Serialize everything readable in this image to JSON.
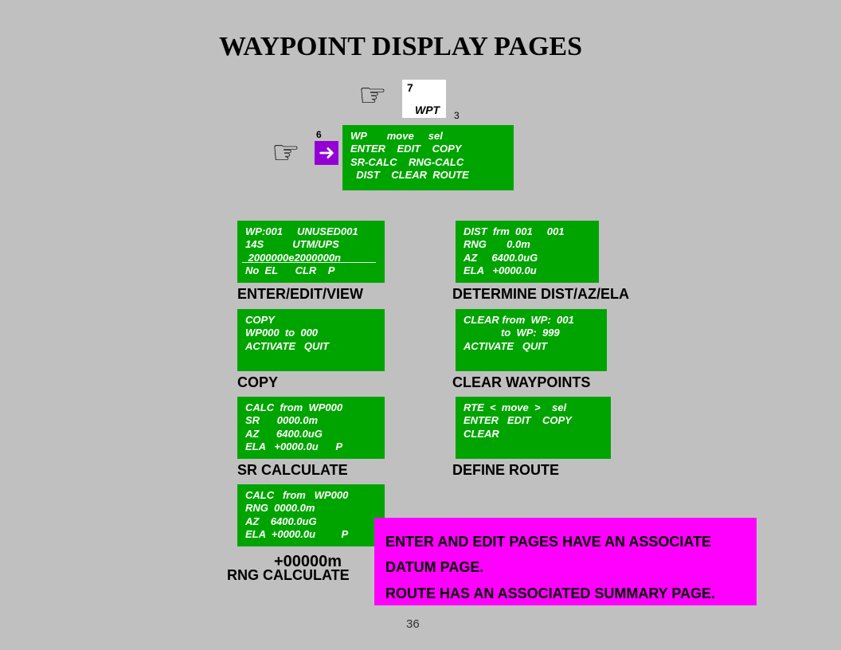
{
  "title": "WAYPOINT DISPLAY PAGES",
  "page_number": "36",
  "wpt_box": {
    "digit": "7",
    "label": "WPT",
    "side_digit": "3"
  },
  "menu_panel": {
    "line1": "WP       move     sel",
    "line2": "ENTER    EDIT    COPY",
    "line3": "SR-CALC    RNG-CALC",
    "line4": "  DIST    CLEAR  ROUTE"
  },
  "enter_key_digit": "6",
  "panels": {
    "enter_edit": {
      "l1": "WP:001     UNUSED001",
      "l2": "14S          UTM/UPS",
      "l3": " 2000000e2000000n",
      "l4": "No  EL      CLR    P",
      "caption": "ENTER/EDIT/VIEW"
    },
    "dist": {
      "l1": "DIST  frm  001     001",
      "l2": "RNG       0.0m",
      "l3": "AZ     6400.0uG",
      "l4": "ELA   +0000.0u",
      "caption": "DETERMINE DIST/AZ/ELA"
    },
    "copy": {
      "l1": "COPY",
      "l2": "WP000  to  000",
      "l3": "",
      "l4": "ACTIVATE   QUIT",
      "caption": "COPY"
    },
    "clear": {
      "l1": "CLEAR from  WP:  001",
      "l2": "             to  WP:  999",
      "l3": "",
      "l4": "ACTIVATE   QUIT",
      "caption": "CLEAR WAYPOINTS"
    },
    "sr": {
      "l1": "CALC  from  WP000",
      "l2": "SR      0000.0m",
      "l3": "AZ      6400.0uG",
      "l4": "ELA   +0000.0u      P",
      "caption": "SR CALCULATE"
    },
    "route": {
      "l1": "RTE  <  move  >    sel",
      "l2": "ENTER   EDIT    COPY",
      "l3": "CLEAR",
      "caption": "DEFINE ROUTE"
    },
    "rng": {
      "l1": "CALC   from   WP000",
      "l2": "RNG  0000.0m",
      "l3": "AZ    6400.0uG",
      "l4": "ELA  +0000.0u         P",
      "caption": "RNG CALCULATE"
    }
  },
  "elevation_overlay": "+00000m",
  "note": {
    "line1": "ENTER AND EDIT PAGES HAVE AN ASSOCIATE",
    "line2": "DATUM PAGE.",
    "line3": "ROUTE HAS AN ASSOCIATED SUMMARY PAGE."
  }
}
